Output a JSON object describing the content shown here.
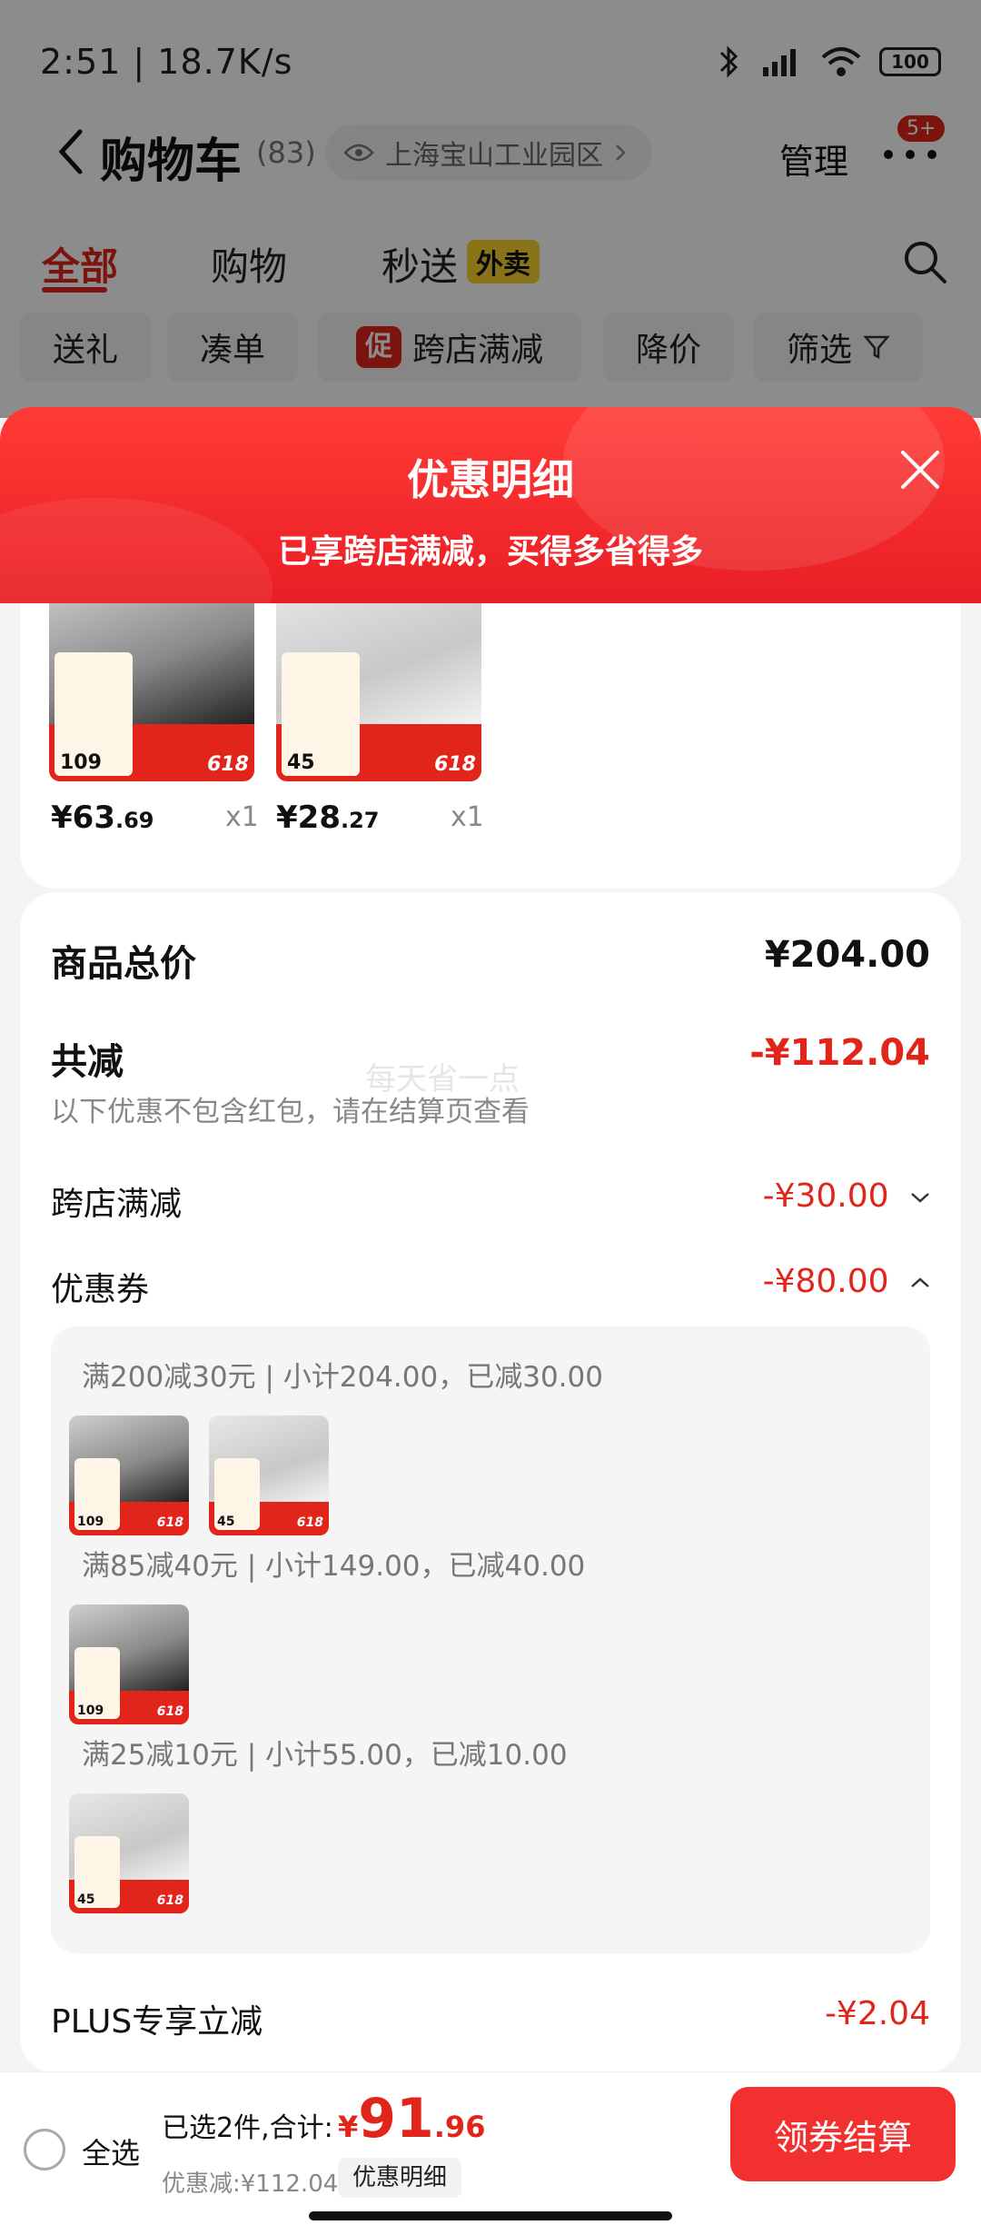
{
  "status": {
    "time_speed": "2:51 | 18.7K/s",
    "battery": "100"
  },
  "nav": {
    "title": "购物车",
    "count": "(83)",
    "address": "上海宝山工业园区",
    "manage": "管理",
    "badge": "5+"
  },
  "tabs": [
    {
      "label": "全部"
    },
    {
      "label": "购物"
    },
    {
      "label": "秒送"
    }
  ],
  "tab_badge": "外卖",
  "chips": [
    "送礼",
    "凑单",
    "跨店满减",
    "降价",
    "筛选"
  ],
  "promo_tag": "促",
  "sheet": {
    "title": "优惠明细",
    "subtitle": "已享跨店满减，买得多省得多"
  },
  "items": [
    {
      "price_int": "¥63",
      "price_dec": ".69",
      "qty": "x1",
      "tag_price": "109",
      "b618": "618"
    },
    {
      "price_int": "¥28",
      "price_dec": ".27",
      "qty": "x1",
      "tag_price": "45",
      "b618": "618"
    }
  ],
  "summary": {
    "total_label": "商品总价",
    "total_value": "¥204.00",
    "reduce_label": "共减",
    "reduce_value": "-¥112.04",
    "note": "以下优惠不包含红包，请在结算页查看",
    "watermark": "每天省一点",
    "cross_store_label": "跨店满减",
    "cross_store_value": "-¥30.00",
    "coupon_label": "优惠券",
    "coupon_value": "-¥80.00",
    "plus_label": "PLUS专享立减",
    "plus_value": "-¥2.04"
  },
  "coupons": [
    {
      "line": "满200减30元 | 小计204.00，已减30.00"
    },
    {
      "line": "满85减40元 | 小计149.00，已减40.00"
    },
    {
      "line": "满25减10元 | 小计55.00，已减10.00"
    }
  ],
  "bottom": {
    "select_all": "全选",
    "selected": "已选2件,合计:",
    "yen": "¥",
    "total_int": "91",
    "total_dec": ".96",
    "discount": "优惠减:¥112.04",
    "detail_btn": "优惠明细",
    "checkout": "领券结算"
  }
}
